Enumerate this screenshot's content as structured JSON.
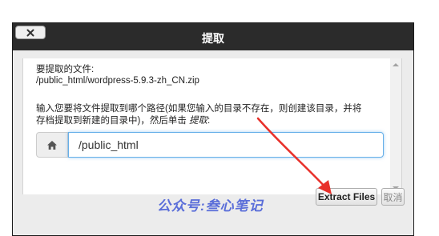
{
  "dialog": {
    "title": "提取",
    "close_icon": "close-icon"
  },
  "body": {
    "file_label": "要提取的文件:",
    "file_path": "/public_html/wordpress-5.9.3-zh_CN.zip",
    "instruction_line1": "输入您要将文件提取到哪个路径(如果您输入的目录不存在，则创建该目录，并将",
    "instruction_line2": "存档提取到新建的目录中)，然后单击 ",
    "instruction_action": "提取",
    "instruction_suffix": ":"
  },
  "path_input": {
    "icon": "home-icon",
    "value": "/public_html"
  },
  "buttons": {
    "extract_label": "Extract Files",
    "cancel_label": "取消"
  },
  "watermark": "公众号:叁心笔记",
  "colors": {
    "titlebar": "#2b2b2b",
    "arrow": "#e8302a",
    "input_focus": "#66afe9",
    "watermark": "#5a6ed9"
  }
}
